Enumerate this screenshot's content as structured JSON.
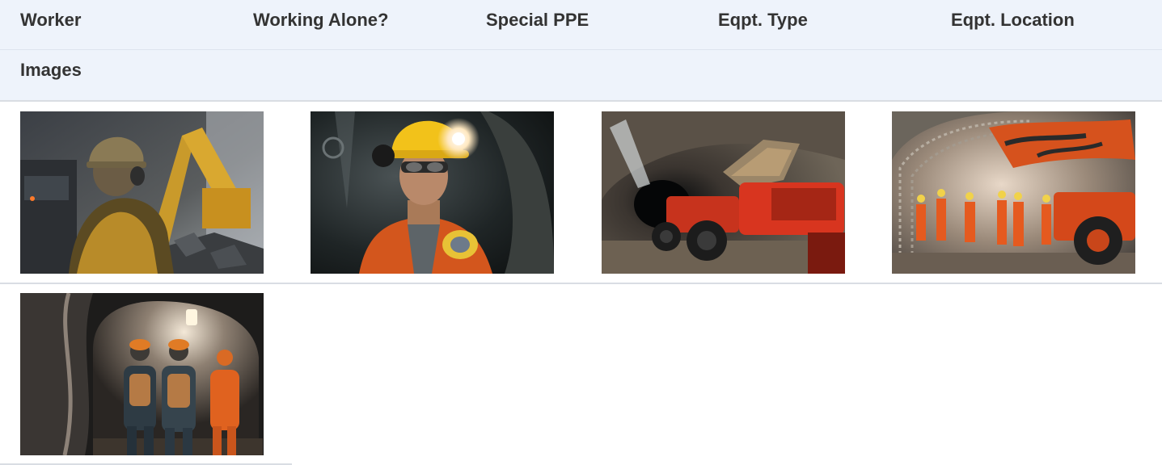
{
  "columns": {
    "worker": "Worker",
    "working_alone": "Working Alone?",
    "special_ppe": "Special PPE",
    "eqpt_type": "Eqpt. Type",
    "eqpt_location": "Eqpt. Location",
    "images": "Images"
  },
  "colors": {
    "header_bg": "#eef3fb",
    "row_divider": "#d9dde3",
    "safety_orange": "#e8561d",
    "helmet_yellow": "#f2c21a"
  },
  "images": [
    {
      "name": "worker-hardhat-machinery-image"
    },
    {
      "name": "worker-headlamp-portrait-image"
    },
    {
      "name": "loader-tunnel-image"
    },
    {
      "name": "drill-rig-crew-image"
    },
    {
      "name": "workers-walking-tunnel-image"
    }
  ]
}
